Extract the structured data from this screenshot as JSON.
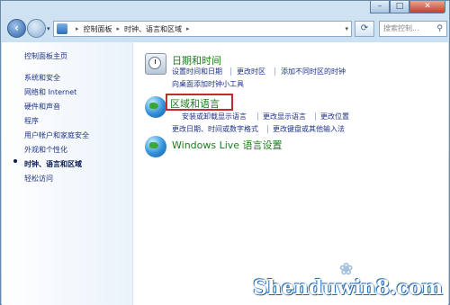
{
  "address": {
    "crumbs": [
      "控制面板",
      "时钟、语言和区域"
    ],
    "search_placeholder": "搜索控制..."
  },
  "sidebar": {
    "items": [
      {
        "label": "控制面板主页"
      },
      {
        "label": "系统和安全"
      },
      {
        "label": "网络和 Internet"
      },
      {
        "label": "硬件和声音"
      },
      {
        "label": "程序"
      },
      {
        "label": "用户帐户和家庭安全"
      },
      {
        "label": "外观和个性化"
      },
      {
        "label": "时钟、语言和区域",
        "current": true
      },
      {
        "label": "轻松访问"
      }
    ]
  },
  "categories": [
    {
      "title": "日期和时间",
      "icon": "clock-icon",
      "links": [
        "设置时间和日期",
        "更改时区",
        "添加不同时区的时钟",
        "向桌面添加时钟小工具"
      ]
    },
    {
      "title": "区域和语言",
      "icon": "globe-icon",
      "links": [
        "安装或卸载显示语言",
        "更改显示语言",
        "更改位置",
        "更改日期、时间或数字格式",
        "更改键盘或其他输入法"
      ]
    },
    {
      "title": "Windows Live 语言设置",
      "icon": "globe-icon",
      "links": []
    }
  ],
  "watermark": "Shenduwin8.com",
  "colors": {
    "highlight_box": "#c42a2a",
    "category_title": "#1e7b1e",
    "link": "#1e3287"
  }
}
